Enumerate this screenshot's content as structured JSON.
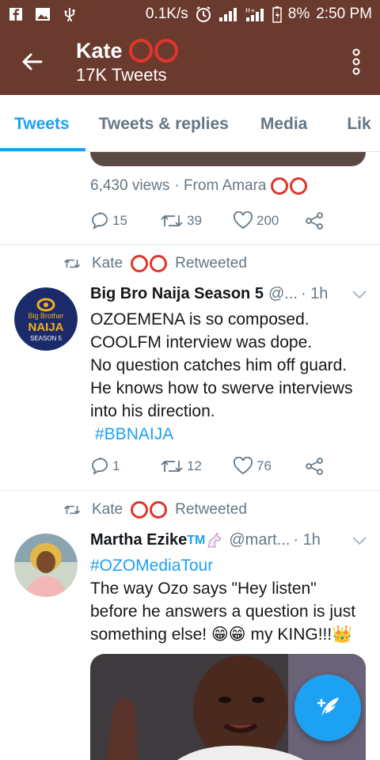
{
  "status_bar": {
    "speed": "0.1K/s",
    "battery": "8%",
    "time": "2:50 PM"
  },
  "header": {
    "name": "Kate",
    "tweet_count": "17K Tweets"
  },
  "tabs": [
    {
      "label": "Tweets"
    },
    {
      "label": "Tweets & replies"
    },
    {
      "label": "Media"
    },
    {
      "label": "Lik"
    }
  ],
  "tweet0": {
    "views": "6,430 views",
    "from": "· From Amara",
    "replies": "15",
    "retweets": "39",
    "likes": "200"
  },
  "tweet1": {
    "retweeted_by": "Kate",
    "retweeted_label": "Retweeted",
    "name": "Big Bro Naija Season 5",
    "handle": "@...",
    "time": "· 1h",
    "lines": [
      "OZOEMENA is so composed.",
      "COOLFM interview was dope.",
      "No question catches him off guard.",
      "He knows how to swerve interviews",
      "into his direction."
    ],
    "hashtag": "#BBNAIJA",
    "replies": "1",
    "retweets": "12",
    "likes": "76",
    "avatar_text": [
      "Big Brother",
      "NAIJA",
      "SEASON 5"
    ]
  },
  "tweet2": {
    "retweeted_by": "Kate",
    "retweeted_label": "Retweeted",
    "name": "Martha Ezike",
    "tm": "TM",
    "handle": "@mart...",
    "time": "· 1h",
    "hashtag": "#OZOMediaTour",
    "lines": [
      "The way Ozo says \"Hey listen\"",
      "before he answers a question is just",
      "something else! 😁😁 my KING!!!👑"
    ]
  },
  "colors": {
    "header_bg": "#6b3a2e",
    "accent": "#1da1f2",
    "muted": "#657786",
    "ring": "#e0352b"
  }
}
